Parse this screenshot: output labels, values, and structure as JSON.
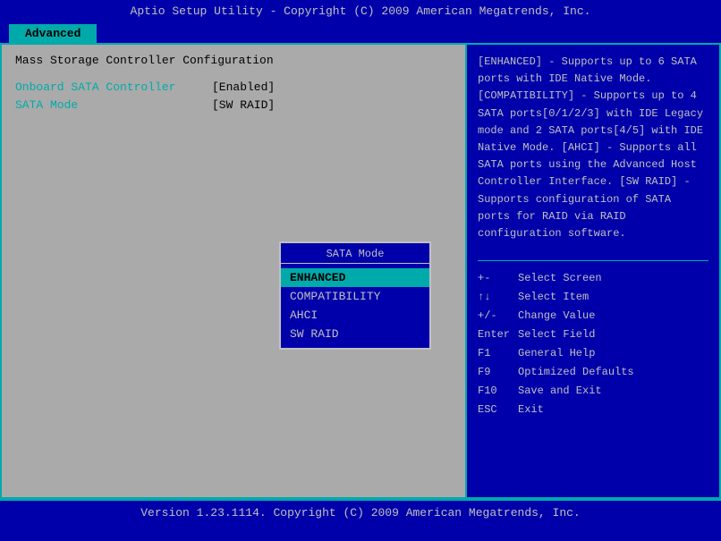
{
  "title_bar": {
    "text": "Aptio Setup Utility - Copyright (C) 2009 American Megatrends, Inc."
  },
  "tabs": [
    {
      "label": "Advanced",
      "active": true
    }
  ],
  "left_panel": {
    "heading": "Mass Storage Controller Configuration",
    "items": [
      {
        "label": "Onboard SATA Controller",
        "value": "[Enabled]"
      },
      {
        "label": "SATA Mode",
        "value": "[SW RAID]"
      }
    ]
  },
  "dropdown": {
    "title": "SATA Mode",
    "options": [
      {
        "label": "ENHANCED",
        "selected": true
      },
      {
        "label": "COMPATIBILITY",
        "selected": false
      },
      {
        "label": "AHCI",
        "selected": false
      },
      {
        "label": "SW RAID",
        "selected": false
      }
    ]
  },
  "right_panel": {
    "help_text": "[ENHANCED] - Supports up to 6 SATA ports with IDE Native Mode. [COMPATIBILITY] - Supports up to 4 SATA ports[0/1/2/3] with IDE Legacy mode and 2 SATA ports[4/5] with IDE Native Mode. [AHCI] - Supports all SATA ports using the Advanced Host Controller Interface. [SW RAID] - Supports configuration of SATA ports for RAID via RAID configuration software.",
    "keys": [
      {
        "key": "+-",
        "desc": "Select Screen"
      },
      {
        "key": "↑↓",
        "desc": "Select Item"
      },
      {
        "key": "+/-",
        "desc": "Change Value"
      },
      {
        "key": "Enter",
        "desc": "Select Field"
      },
      {
        "key": "F1",
        "desc": "General Help"
      },
      {
        "key": "F9",
        "desc": "Optimized Defaults"
      },
      {
        "key": "F10",
        "desc": "Save and Exit"
      },
      {
        "key": "ESC",
        "desc": "Exit"
      }
    ]
  },
  "footer": {
    "text": "Version 1.23.1114. Copyright (C) 2009 American Megatrends, Inc."
  }
}
